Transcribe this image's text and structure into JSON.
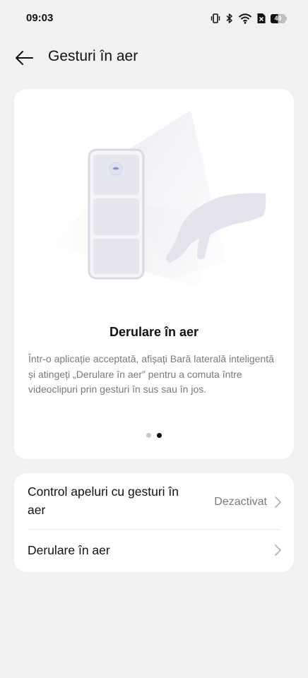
{
  "status_bar": {
    "time": "09:03",
    "battery_level": "49",
    "icons": [
      "vibrate-icon",
      "bluetooth-icon",
      "wifi-icon",
      "no-sim-icon",
      "battery-icon"
    ]
  },
  "header": {
    "title": "Gesturi în aer",
    "back_icon": "arrow-left-icon"
  },
  "feature_card": {
    "illustration": "phone-and-hand-gesture-illustration",
    "title": "Derulare în aer",
    "description": "Într-o aplicație acceptată, afișați Bară laterală inteligentă și atingeți „Derulare în aer” pentru a comuta între videoclipuri prin gesturi în sus sau în jos.",
    "pages_total": 2,
    "active_page": 2
  },
  "settings": {
    "items": [
      {
        "label": "Control apeluri cu gesturi în aer",
        "value": "Dezactivat"
      },
      {
        "label": "Derulare în aer",
        "value": ""
      }
    ]
  },
  "colors": {
    "background": "#f1f1f3",
    "card": "#ffffff",
    "text_primary": "#111111",
    "text_secondary": "#7a7a7e"
  }
}
